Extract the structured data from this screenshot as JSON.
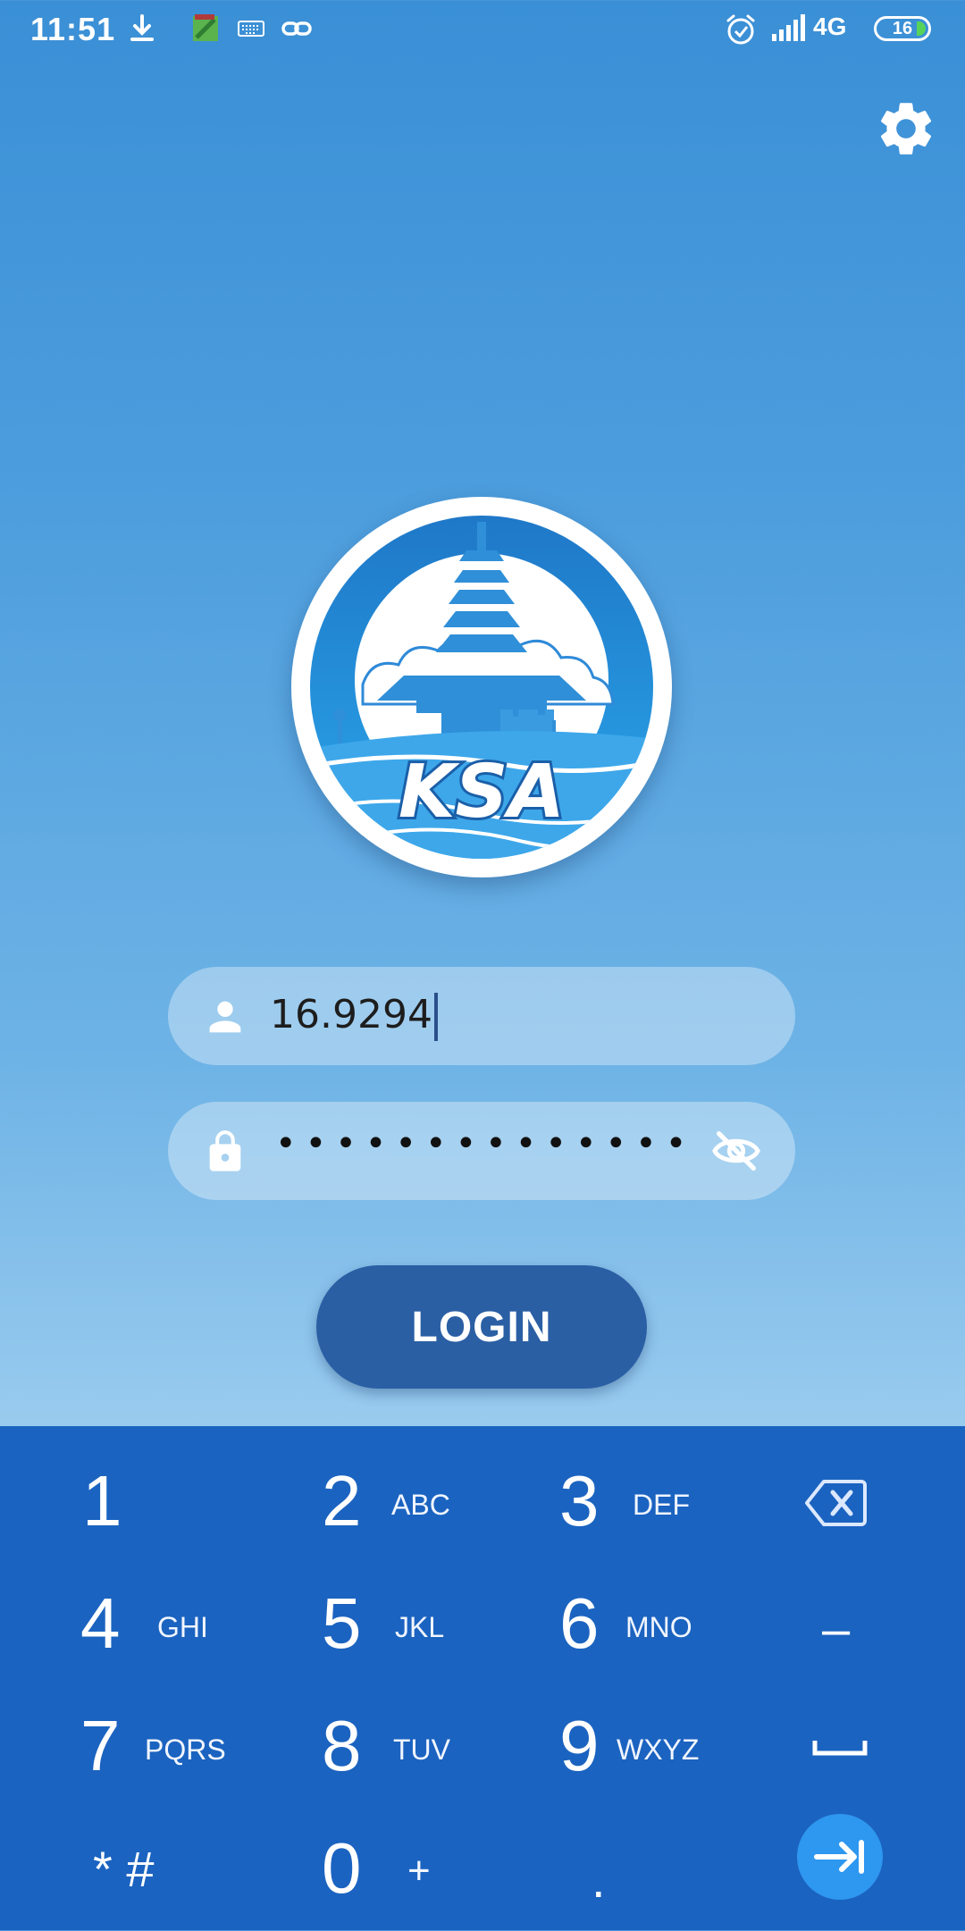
{
  "status_bar": {
    "time": "11:51",
    "network": "4G",
    "battery": "16",
    "icons": [
      "download-icon",
      "app-notification-icon",
      "keyboard-icon",
      "link-icon",
      "alarm-icon",
      "signal-icon"
    ]
  },
  "header": {
    "settings_icon": "gear-icon"
  },
  "logo": {
    "text": "KSA"
  },
  "login_form": {
    "username": {
      "icon": "person-icon",
      "value": "16.9294"
    },
    "password": {
      "icon": "lock-icon",
      "masked_value": "••••••••••••••",
      "visibility_icon": "eye-off-icon"
    },
    "login_label": "LOGIN"
  },
  "keyboard": {
    "rows": [
      [
        {
          "num": "1",
          "letters": ""
        },
        {
          "num": "2",
          "letters": "ABC"
        },
        {
          "num": "3",
          "letters": "DEF"
        }
      ],
      [
        {
          "num": "4",
          "letters": "GHI"
        },
        {
          "num": "5",
          "letters": "JKL"
        },
        {
          "num": "6",
          "letters": "MNO"
        }
      ],
      [
        {
          "num": "7",
          "letters": "PQRS"
        },
        {
          "num": "8",
          "letters": "TUV"
        },
        {
          "num": "9",
          "letters": "WXYZ"
        }
      ],
      [
        {
          "num": "* #",
          "letters": ""
        },
        {
          "num": "0",
          "letters": "+"
        },
        {
          "num": ".",
          "letters": ""
        }
      ]
    ],
    "minus": "–",
    "special_icons": [
      "backspace-icon",
      "space-icon",
      "tab-next-icon"
    ]
  },
  "colors": {
    "keyboard_bg": "#1b63c0",
    "login_button": "#2a5fa4",
    "tab_button": "#2e97f0"
  }
}
